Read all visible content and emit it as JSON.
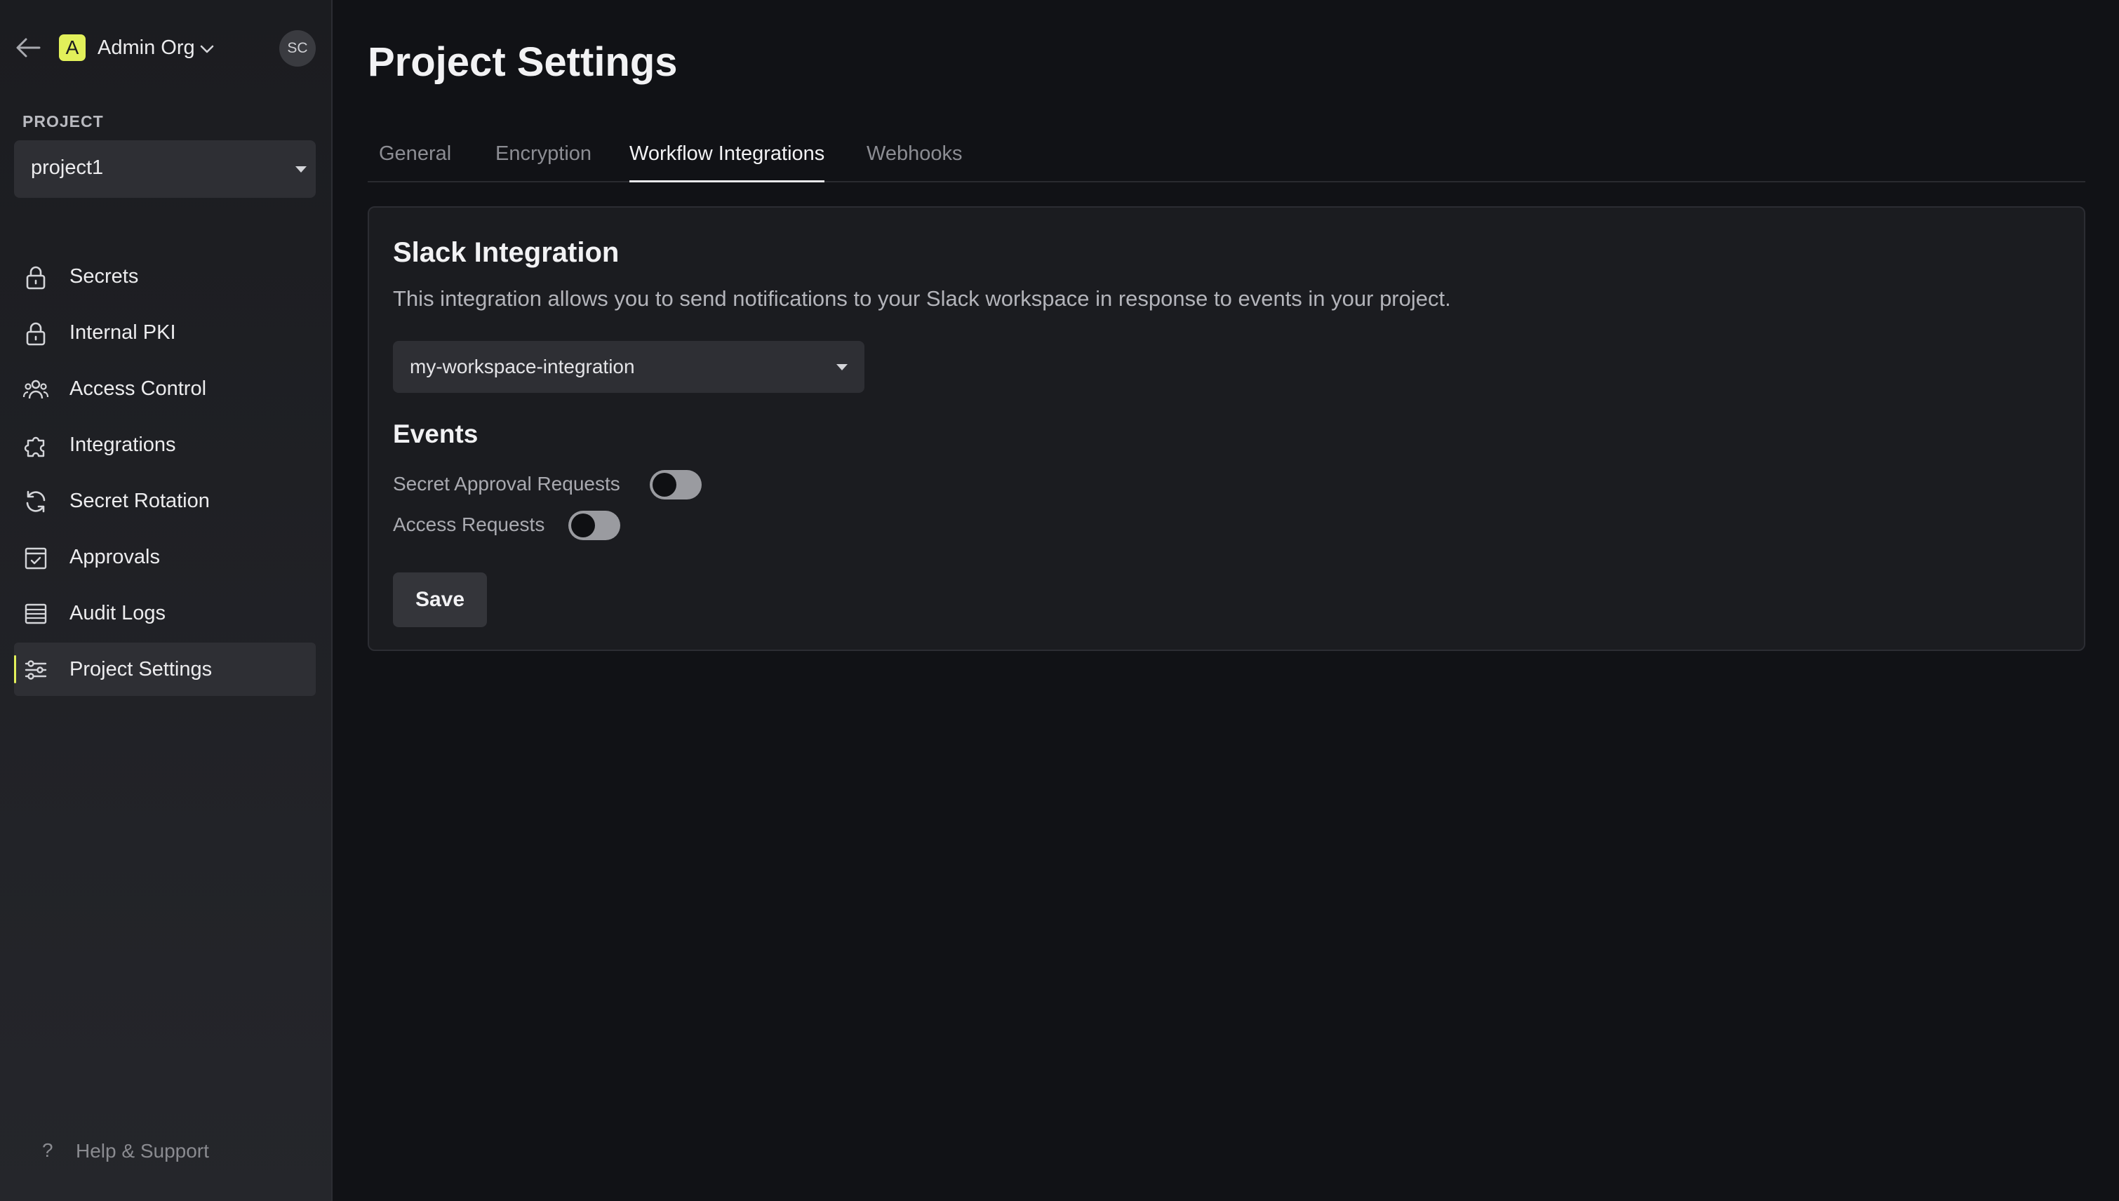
{
  "sidebar": {
    "org": {
      "initial": "A",
      "name": "Admin Org"
    },
    "user_initials": "SC",
    "project_label": "PROJECT",
    "project_select_value": "project1",
    "items": [
      {
        "label": "Secrets",
        "icon": "lock-icon"
      },
      {
        "label": "Internal PKI",
        "icon": "lock-icon"
      },
      {
        "label": "Access Control",
        "icon": "users-icon"
      },
      {
        "label": "Integrations",
        "icon": "puzzle-icon"
      },
      {
        "label": "Secret Rotation",
        "icon": "refresh-icon"
      },
      {
        "label": "Approvals",
        "icon": "calendar-check-icon"
      },
      {
        "label": "Audit Logs",
        "icon": "list-icon"
      },
      {
        "label": "Project Settings",
        "icon": "sliders-icon"
      }
    ],
    "active_item": "Project Settings",
    "help_icon": "?",
    "help_label": "Help & Support"
  },
  "main": {
    "title": "Project Settings",
    "tabs": [
      {
        "label": "General"
      },
      {
        "label": "Encryption"
      },
      {
        "label": "Workflow Integrations"
      },
      {
        "label": "Webhooks"
      }
    ],
    "active_tab": "Workflow Integrations",
    "slack": {
      "title": "Slack Integration",
      "description": "This integration allows you to send notifications to your Slack workspace in response to events in your project.",
      "workspace_select_value": "my-workspace-integration",
      "events_title": "Events",
      "events": [
        {
          "label": "Secret Approval Requests",
          "enabled": false
        },
        {
          "label": "Access Requests",
          "enabled": false
        }
      ],
      "save_label": "Save"
    }
  },
  "colors": {
    "accent": "#e2f05a",
    "background": "#111216",
    "sidebar": "#1b1c20",
    "card": "#1b1c20"
  }
}
